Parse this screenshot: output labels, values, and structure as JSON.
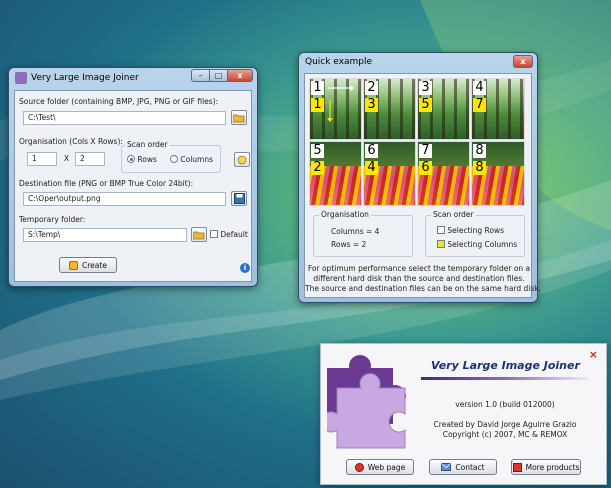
{
  "main_window": {
    "title": "Very Large Image Joiner",
    "source_label": "Source folder (containing BMP, JPG, PNG or GIF files):",
    "source_value": "C:\\Test\\",
    "organisation_label": "Organisation (Cols X Rows):",
    "cols_value": "1",
    "x_sep": "X",
    "rows_value": "2",
    "scan_order_label": "Scan order",
    "scan_rows_label": "Rows",
    "scan_columns_label": "Columns",
    "destination_label": "Destination file (PNG or BMP True Color 24bit):",
    "destination_value": "C:\\Oper\\output.png",
    "temp_label": "Temporary folder:",
    "temp_value": "S:\\Temp\\",
    "default_label": "Default",
    "create_label": "Create",
    "info_icon_text": "i"
  },
  "quick_window": {
    "title": "Quick example",
    "white_numbers": [
      "1",
      "2",
      "3",
      "4",
      "5",
      "6",
      "7",
      "8"
    ],
    "yellow_numbers": [
      "1",
      "3",
      "5",
      "7",
      "2",
      "4",
      "6",
      "8"
    ],
    "organisation_title": "Organisation",
    "columns_text": "Columns = 4",
    "rows_text": "Rows = 2",
    "scan_order_title": "Scan order",
    "selecting_rows": "Selecting Rows",
    "selecting_columns": "Selecting Columns",
    "note_line1": "For optimum performance select the temporary folder on a",
    "note_line2": "different hard disk than the source and destination files.",
    "note_line3": "The source and destination files can be on the same hard disk."
  },
  "about_box": {
    "title": "Very Large Image Joiner",
    "version": "version 1.0 (build 012000)",
    "created_by": "Created by David Jorge Aguirre Grazio",
    "copyright": "Copyright (c) 2007, MC & REMOX",
    "close_glyph": "×",
    "web_page": "Web page",
    "contact": "Contact",
    "more_products": "More products"
  },
  "window_controls": {
    "minimize": "–",
    "maximize": "□",
    "close": "x"
  },
  "colors": {
    "titlebar": "#b9d4ea",
    "accent_purple": "#7d4ea8",
    "yellow_label": "#ffe600",
    "close_red": "#c9432e"
  }
}
